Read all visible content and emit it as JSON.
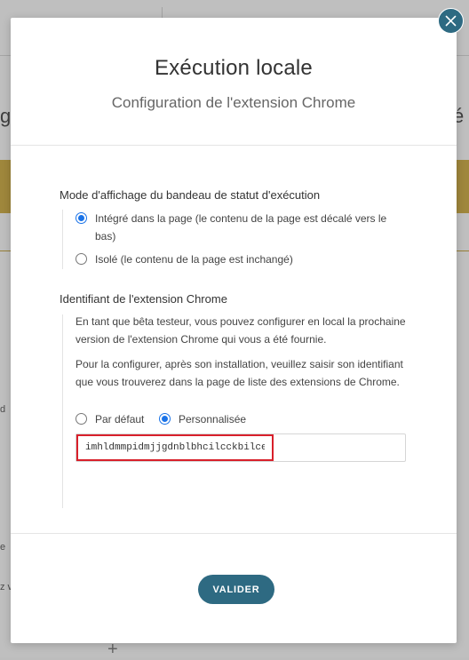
{
  "background": {
    "left_text": "g",
    "right_text": "é",
    "small_text_1": "d",
    "small_text_2": "e",
    "small_text_3": "z v"
  },
  "modal": {
    "title": "Exécution locale",
    "subtitle": "Configuration de l'extension Chrome",
    "close_icon": "close-icon",
    "accent_color": "#2e6a82",
    "radio_color": "#1a73e8",
    "highlight_color": "#d8202b"
  },
  "display_mode": {
    "title": "Mode d'affichage du bandeau de statut d'exécution",
    "options": [
      {
        "label": "Intégré dans la page (le contenu de la page est décalé vers le bas)",
        "checked": true
      },
      {
        "label": "Isolé (le contenu de la page est inchangé)",
        "checked": false
      }
    ]
  },
  "extension_id": {
    "title": "Identifiant de l'extension Chrome",
    "paragraph_1": "En tant que bêta testeur, vous pouvez configurer en local la prochaine version de l'extension Chrome qui vous a été fournie.",
    "paragraph_2": "Pour la configurer, après son installation, veuillez saisir son identifiant que vous trouverez dans la page de liste des extensions de Chrome.",
    "options": [
      {
        "label": "Par défaut",
        "checked": false
      },
      {
        "label": "Personnalisée",
        "checked": true
      }
    ],
    "input_value": "imhldmmpidmjjgdnblbhcilcckbilcel"
  },
  "footer": {
    "submit_label": "VALIDER"
  }
}
